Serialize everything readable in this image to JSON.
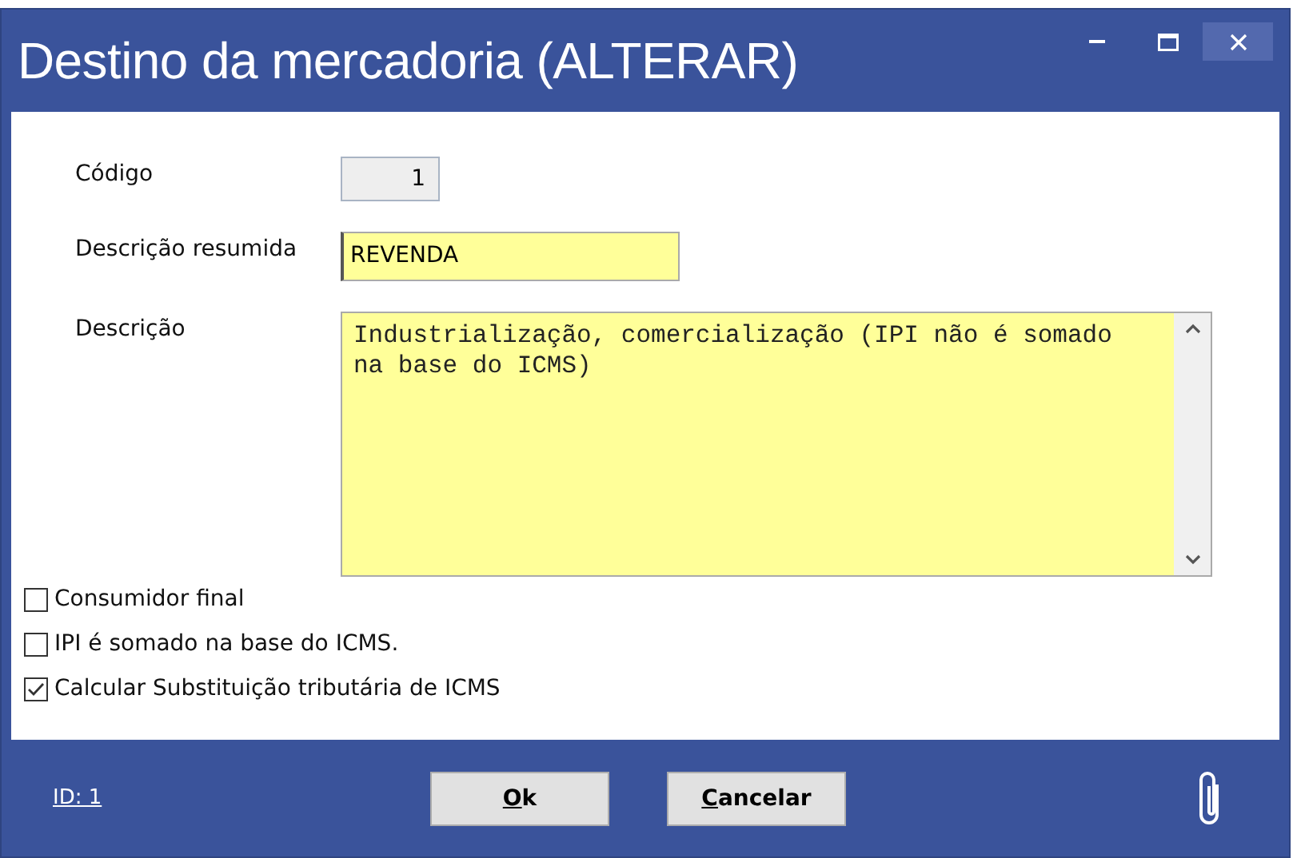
{
  "window": {
    "title": "Destino da mercadoria (ALTERAR)"
  },
  "fields": [
    {
      "label": "Código",
      "value": "1",
      "kind": "readonly"
    },
    {
      "label": "Descrição resumida",
      "value": "REVENDA",
      "kind": "input"
    },
    {
      "label": "Descrição",
      "value": "Industrialização, comercialização (IPI não é somado na base do ICMS)",
      "kind": "textarea"
    }
  ],
  "options": [
    {
      "label": "Consumidor final",
      "checked": false
    },
    {
      "label": "IPI é somado na base do ICMS.",
      "checked": false
    },
    {
      "label": "Calcular Substituição tributária de ICMS",
      "checked": true
    }
  ],
  "footer": {
    "id_link": "ID: 1",
    "buttons": [
      {
        "key": "O",
        "rest": "k"
      },
      {
        "key": "C",
        "rest": "ancelar"
      }
    ]
  }
}
